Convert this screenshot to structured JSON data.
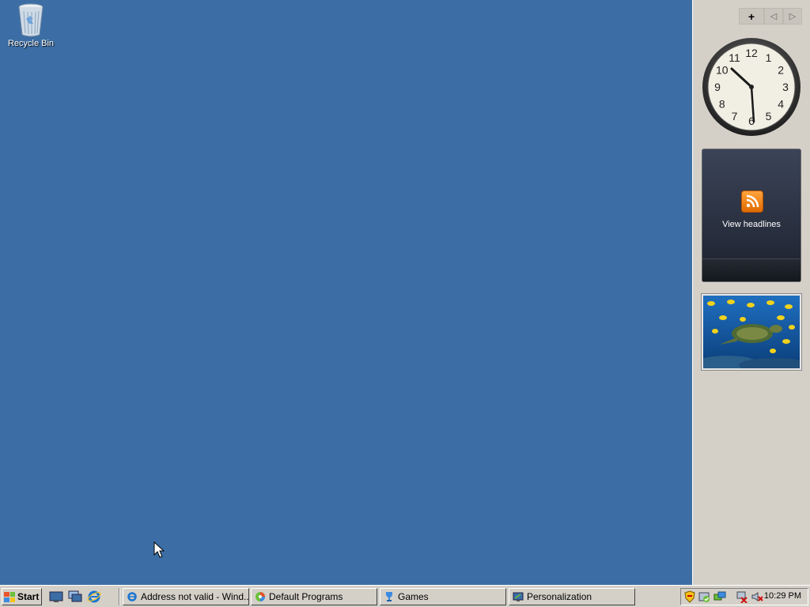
{
  "desktop": {
    "background": "#3c6ea5",
    "icons": [
      {
        "label": "Recycle Bin",
        "icon": "recycle-bin-icon"
      }
    ]
  },
  "sidebar": {
    "controls": {
      "add": "+",
      "prev": "◁",
      "next": "▷"
    },
    "clock": {
      "numbers": [
        "12",
        "1",
        "2",
        "3",
        "4",
        "5",
        "6",
        "7",
        "8",
        "9",
        "10",
        "11"
      ],
      "time": "10:29"
    },
    "feed": {
      "label": "View headlines",
      "icon": "rss-icon"
    },
    "slideshow": {
      "icon": "sea-turtle-image"
    }
  },
  "taskbar": {
    "start_label": "Start",
    "quick_launch": [
      "show-desktop-icon",
      "switch-windows-icon",
      "internet-explorer-icon"
    ],
    "tasks": [
      {
        "label": "Address not valid - Wind...",
        "icon": "internet-explorer-icon"
      },
      {
        "label": "Default Programs",
        "icon": "default-programs-icon"
      },
      {
        "label": "Games",
        "icon": "games-icon"
      },
      {
        "label": "Personalization",
        "icon": "personalization-icon"
      }
    ],
    "tray": {
      "time": "10:29 PM",
      "icons": [
        "security-shield-icon",
        "windows-defender-icon",
        "network-icon",
        "network-disconnected-icon",
        "volume-muted-icon"
      ]
    }
  }
}
